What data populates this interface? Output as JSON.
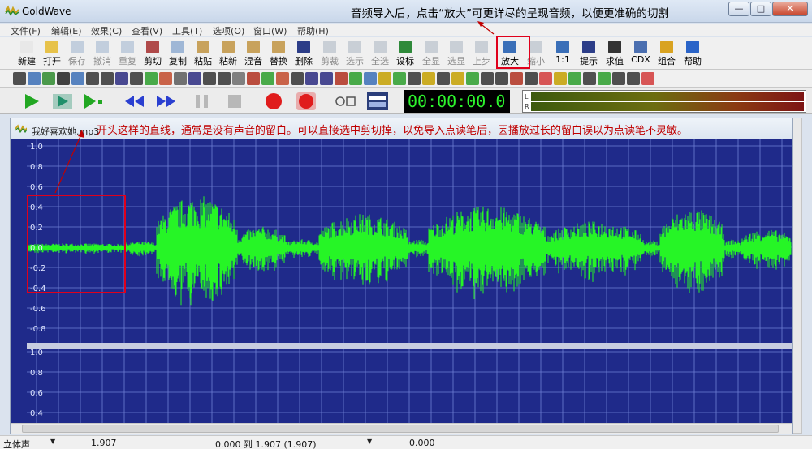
{
  "window": {
    "title": "GoldWave",
    "controls": {
      "minimize": "—",
      "maximize": "□",
      "close": "✕"
    }
  },
  "annotations": {
    "top_tip": "音频导入后，点击“放大”可更详尽的呈现音频，以便更准确的切割",
    "silence_tip": "开头这样的直线，通常是没有声音的留白。可以直接选中剪切掉，以免导入点读笔后，因播放过长的留白误以为点读笔不灵敏。"
  },
  "menu": [
    "文件(F)",
    "编辑(E)",
    "效果(C)",
    "查看(V)",
    "工具(T)",
    "选项(O)",
    "窗口(W)",
    "帮助(H)"
  ],
  "toolbar": {
    "buttons": [
      {
        "label": "新建",
        "icon": "new-file-icon",
        "enabled": true,
        "color": "#e8e8e8"
      },
      {
        "label": "打开",
        "icon": "open-folder-icon",
        "enabled": true,
        "color": "#e7c24a"
      },
      {
        "label": "保存",
        "icon": "save-icon",
        "enabled": false,
        "color": "#8aa4c6"
      },
      {
        "label": "撤消",
        "icon": "undo-icon",
        "enabled": false,
        "color": "#8aa4c6"
      },
      {
        "label": "重复",
        "icon": "redo-icon",
        "enabled": false,
        "color": "#8aa4c6"
      },
      {
        "label": "剪切",
        "icon": "scissors-icon",
        "enabled": true,
        "color": "#b04a4a"
      },
      {
        "label": "复制",
        "icon": "copy-icon",
        "enabled": true,
        "color": "#9fb7d6"
      },
      {
        "label": "粘贴",
        "icon": "paste-icon",
        "enabled": true,
        "color": "#c8a25c"
      },
      {
        "label": "粘新",
        "icon": "paste-new-icon",
        "enabled": true,
        "color": "#c8a25c"
      },
      {
        "label": "混音",
        "icon": "mix-icon",
        "enabled": true,
        "color": "#c8a25c"
      },
      {
        "label": "替换",
        "icon": "replace-icon",
        "enabled": true,
        "color": "#c8a25c"
      },
      {
        "label": "删除",
        "icon": "delete-icon",
        "enabled": true,
        "color": "#2c3d88"
      },
      {
        "label": "剪裁",
        "icon": "trim-icon",
        "enabled": false,
        "color": "#9aa6b5"
      },
      {
        "label": "选示",
        "icon": "select-view-icon",
        "enabled": false,
        "color": "#9aa6b5"
      },
      {
        "label": "全选",
        "icon": "select-all-icon",
        "enabled": false,
        "color": "#9aa6b5"
      },
      {
        "label": "设标",
        "icon": "set-marker-icon",
        "enabled": true,
        "color": "#2f8a3a"
      },
      {
        "label": "全显",
        "icon": "show-all-icon",
        "enabled": false,
        "color": "#9aa6b5"
      },
      {
        "label": "选显",
        "icon": "show-selection-icon",
        "enabled": false,
        "color": "#9aa6b5"
      },
      {
        "label": "上步",
        "icon": "previous-view-icon",
        "enabled": false,
        "color": "#9aa6b5"
      },
      {
        "label": "放大",
        "icon": "zoom-in-icon",
        "enabled": true,
        "color": "#3a6fb8"
      },
      {
        "label": "缩小",
        "icon": "zoom-out-icon",
        "enabled": false,
        "color": "#9aa6b5"
      },
      {
        "label": "1:1",
        "icon": "zoom-1-1-icon",
        "enabled": true,
        "color": "#3a6fb8"
      },
      {
        "label": "提示",
        "icon": "cue-icon",
        "enabled": true,
        "color": "#2c3d88"
      },
      {
        "label": "求值",
        "icon": "evaluate-icon",
        "enabled": true,
        "color": "#333333"
      },
      {
        "label": "CDX",
        "icon": "cdx-icon",
        "enabled": true,
        "color": "#4b6fb0"
      },
      {
        "label": "组合",
        "icon": "combine-icon",
        "enabled": true,
        "color": "#d9a321"
      },
      {
        "label": "帮助",
        "icon": "help-icon",
        "enabled": true,
        "color": "#2a64c8"
      }
    ]
  },
  "effects_toolbar": {
    "icon_colors": [
      "#333",
      "#3b6fb6",
      "#2e8a2e",
      "#222",
      "#3b6fb6",
      "#333",
      "#333",
      "#2b2b80",
      "#333",
      "#2b9e2b",
      "#c24a2c",
      "#5a5a5a",
      "#2b2b80",
      "#333",
      "#333",
      "#6c6c6c",
      "#b0301f",
      "#2b9e2b",
      "#c24a2c",
      "#333",
      "#2b2b80",
      "#2b2b80",
      "#b0301f",
      "#2b9e2b",
      "#3b6fb6",
      "#c4a000",
      "#2b9e2b",
      "#333",
      "#c4a000",
      "#333",
      "#c4a000",
      "#2b9e2b",
      "#333",
      "#333",
      "#b0301f",
      "#333",
      "#d23a3a",
      "#c4a000",
      "#2b9e2b",
      "#333",
      "#2b9e2b",
      "#333",
      "#333",
      "#d23a3a"
    ]
  },
  "transport": {
    "buttons": [
      {
        "name": "play-button",
        "icon": "play-icon",
        "color": "#22a722"
      },
      {
        "name": "play-selection-button",
        "icon": "play-selection-icon",
        "color": "#1f8f6a"
      },
      {
        "name": "play-from-cursor-button",
        "icon": "play-cursor-icon",
        "color": "#22a722"
      },
      {
        "name": "rewind-button",
        "icon": "rewind-icon",
        "color": "#2a3fd0"
      },
      {
        "name": "fast-forward-button",
        "icon": "fast-forward-icon",
        "color": "#2a3fd0"
      },
      {
        "name": "pause-button",
        "icon": "pause-icon",
        "color": "#b8b8b8"
      },
      {
        "name": "stop-button",
        "icon": "stop-icon",
        "color": "#b8b8b8"
      },
      {
        "name": "record-button",
        "icon": "record-icon",
        "color": "#e01c1c"
      },
      {
        "name": "record-new-button",
        "icon": "record-new-icon",
        "color": "#e01c1c"
      },
      {
        "name": "device-controls-button",
        "icon": "device-controls-icon",
        "color": "#555555"
      },
      {
        "name": "properties-button",
        "icon": "properties-icon",
        "color": "#2b3e7a"
      }
    ],
    "time": "00:00:00.0",
    "meter_labels": {
      "left": "L",
      "right": "R"
    }
  },
  "document": {
    "filename": "我好喜欢她.mp3",
    "y_ticks_top": [
      "1.0",
      "0.8",
      "0.6",
      "0.4",
      "0.2",
      "0.0",
      "-0.2",
      "-0.4",
      "-0.6",
      "-0.8"
    ],
    "y_ticks_bottom": [
      "1.0",
      "0.8",
      "0.6",
      "0.4"
    ],
    "waveform_color": "#26f526",
    "background_color": "#1f2a8a",
    "grid_color": "#6f7fd3"
  },
  "status": {
    "channel": "立体声",
    "length": "1.907",
    "selection": "0.000 到 1.907 (1.907)",
    "position": "0.000"
  }
}
